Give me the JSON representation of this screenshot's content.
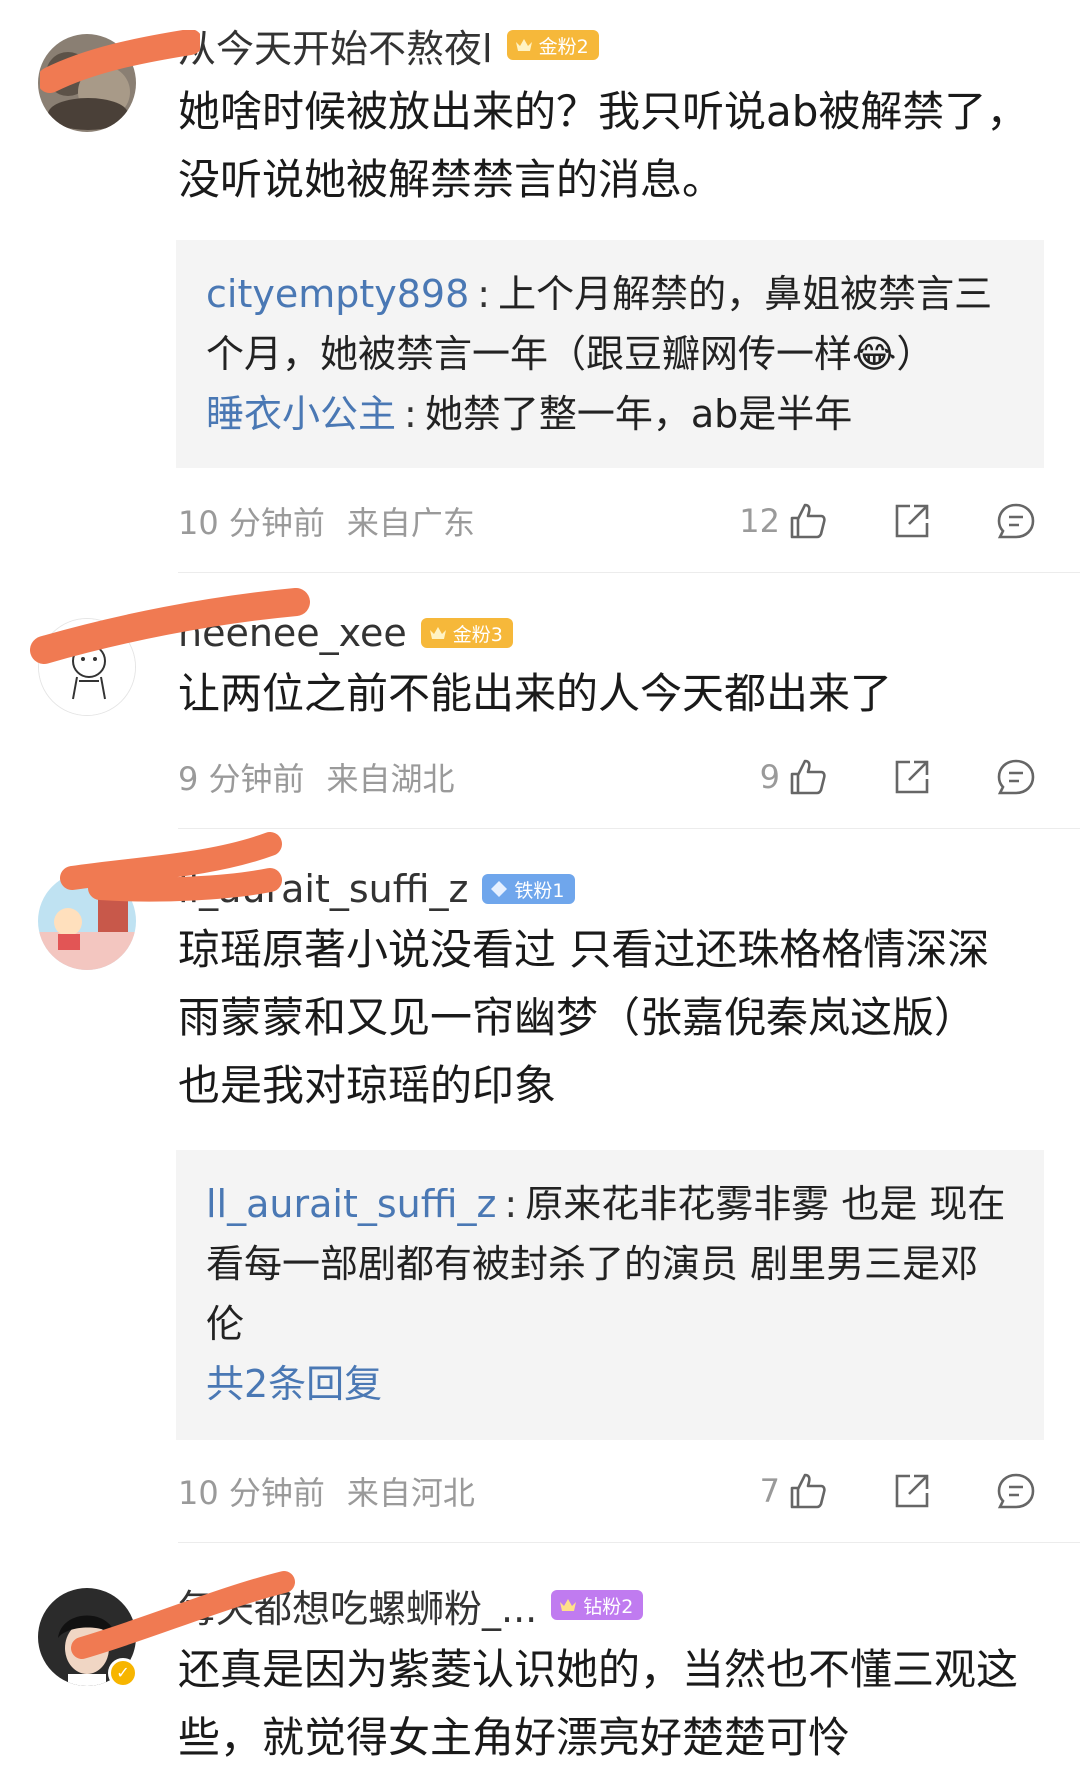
{
  "comments": [
    {
      "username": "从今天开始不熬夜l",
      "badge": "金粉2",
      "text": "她啥时候被放出来的？我只听说ab被解禁了，没听说她被解禁禁言的消息。",
      "replies": [
        {
          "name": "cityempty898",
          "text": "上个月解禁的，鼻姐被禁言三个月，她被禁言一年（跟豆瓣网传一样😂）"
        },
        {
          "name": "睡衣小公主",
          "text": "她禁了整一年，ab是半年"
        }
      ],
      "time": "10 分钟前",
      "location": "来自广东",
      "likes": "12"
    },
    {
      "username": "neenee_xee",
      "badge": "金粉3",
      "text": "让两位之前不能出来的人今天都出来了",
      "time": "9 分钟前",
      "location": "来自湖北",
      "likes": "9"
    },
    {
      "username": "ll_aurait_suffi_z",
      "badge": "铁粉1",
      "text_lines": [
        "琼瑶原著小说没看过 只看过还珠格格情深深",
        "雨蒙蒙和又见一帘幽梦（张嘉倪秦岚这版）",
        "也是我对琼瑶的印象"
      ],
      "replies": [
        {
          "name": "ll_aurait_suffi_z",
          "text": "原来花非花雾非雾 也是 现在看每一部剧都有被封杀了的演员 剧里男三是邓伦"
        }
      ],
      "more_replies": "共2条回复",
      "time": "10 分钟前",
      "location": "来自河北",
      "likes": "7"
    },
    {
      "username": "每天都想吃螺蛳粉_...",
      "badge": "钻粉2",
      "text": "还真是因为紫菱认识她的，当然也不懂三观这些，就觉得女主角好漂亮好楚楚可怜"
    }
  ],
  "colors": {
    "link": "#4a78b4",
    "meta": "#9a9a9a",
    "reply_bg": "#f4f4f4",
    "badge_gold": "#f6b83a",
    "badge_iron": "#6fa6ec",
    "badge_diamond": "#c07bf0",
    "scribble": "#f07a52"
  },
  "icons": {
    "like": "thumbs-up-icon",
    "share": "share-icon",
    "comment": "comment-icon"
  }
}
